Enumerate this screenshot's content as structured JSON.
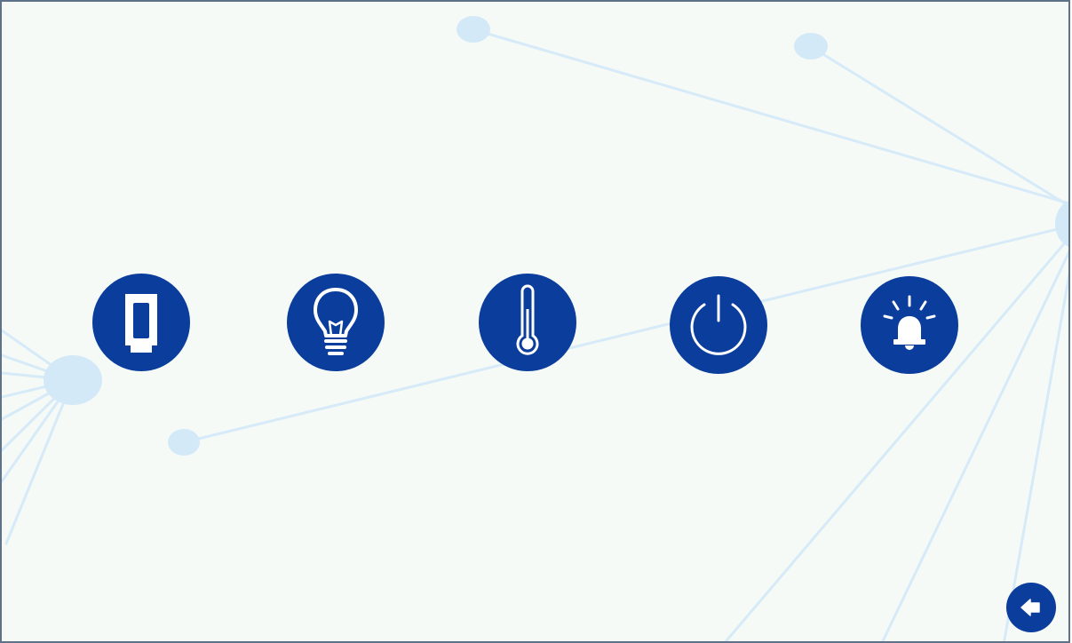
{
  "theme": {
    "accent": "#0a3d9c",
    "background": "#f5faf7",
    "network_color": "#d4e9f7",
    "border": "#5e7388"
  },
  "icon_bar": {
    "items": [
      {
        "name": "device-icon",
        "icon": "battery-device-icon"
      },
      {
        "name": "lighting-icon",
        "icon": "lightbulb-icon"
      },
      {
        "name": "temperature-icon",
        "icon": "thermometer-icon"
      },
      {
        "name": "power-icon",
        "icon": "power-icon"
      },
      {
        "name": "alarm-icon",
        "icon": "alarm-bell-icon"
      }
    ]
  },
  "back_button": {
    "icon": "back-arrow-icon"
  }
}
